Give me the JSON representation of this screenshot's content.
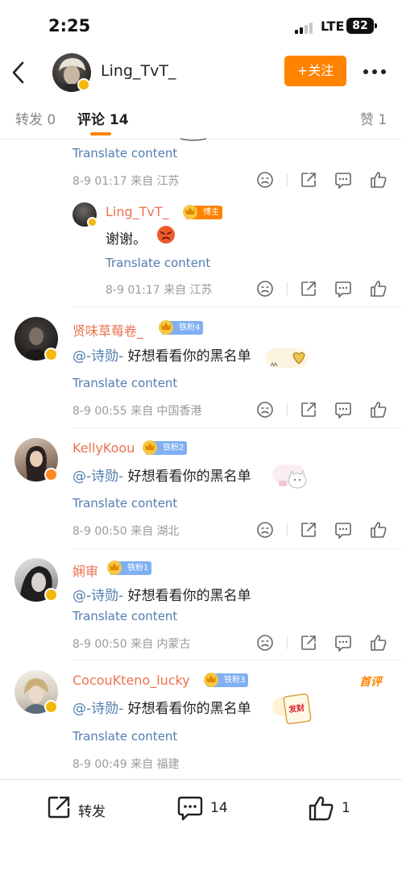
{
  "status_bar": {
    "time": "2:25",
    "network": "LTE",
    "battery": "82"
  },
  "nav": {
    "title": "Ling_TvT_",
    "follow_label": "+关注"
  },
  "tabs": [
    {
      "label": "转发 0"
    },
    {
      "label": "评论 14"
    },
    {
      "label": "赞 1"
    }
  ],
  "comments": [
    {
      "translate": "Translate content",
      "meta": "8-9 01:17  来自 江苏"
    },
    {
      "name": "Ling_TvT_",
      "badge": "博主",
      "text": "谢谢。",
      "translate": "Translate content",
      "meta": "8-9 01:17  来自 江苏"
    },
    {
      "name": "贤味草莓卷_",
      "badge": "铁粉4",
      "mention": "@-诗勋-",
      "text": " 好想看看你的黑名单",
      "translate": "Translate content",
      "meta": "8-9 00:55  来自 中国香港"
    },
    {
      "name": "KellyKoou",
      "badge": "铁粉2",
      "mention": "@-诗勋-",
      "text": " 好想看看你的黑名单",
      "translate": "Translate content",
      "meta": "8-9 00:50  来自 湖北"
    },
    {
      "name": "娴审",
      "badge": "铁粉1",
      "mention": "@-诗勋-",
      "text": " 好想看看你的黑名单",
      "translate": "Translate content",
      "meta": "8-9 00:50  来自 内蒙古"
    },
    {
      "name": "CocouKteno_lucky",
      "badge": "铁粉3",
      "mention": "@-诗勋-",
      "text": " 好想看看你的黑名单",
      "translate": "Translate content",
      "meta": "8-9 00:49  来自 福建",
      "tag": "首评",
      "sticker_text": "发财"
    }
  ],
  "bottom_bar": {
    "repost_label": "转发",
    "comment_count": "14",
    "like_count": "1"
  },
  "colors": {
    "accent": "#ff8200",
    "name": "#eb7350",
    "link": "#507daf",
    "fan_badge": "#7eb0f2"
  }
}
